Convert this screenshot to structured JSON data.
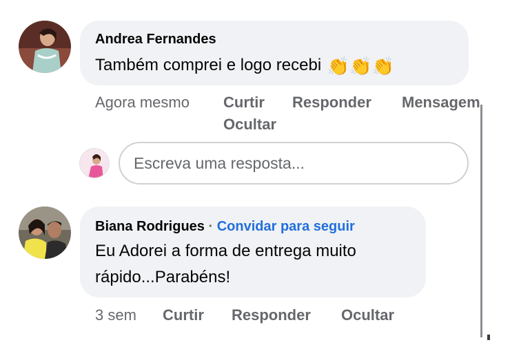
{
  "comments": [
    {
      "author": "Andrea Fernandes",
      "text": "Também comprei e logo recebi",
      "emoji": "👏👏👏",
      "avatar_icon": "profile-photo-woman",
      "actions": {
        "time": "Agora mesmo",
        "like": "Curtir",
        "reply": "Responder",
        "message": "Mensagem",
        "hide": "Ocultar"
      }
    },
    {
      "author": "Biana Rodrigues",
      "separator": "·",
      "follow": "Convidar para seguir",
      "text_line1": "Eu Adorei a forma de entrega muito",
      "text_line2": "rápido...Parabéns!",
      "avatar_icon": "profile-photo-couple",
      "actions": {
        "time": "3 sem",
        "like": "Curtir",
        "reply": "Responder",
        "hide": "Ocultar"
      }
    }
  ],
  "reply_box": {
    "placeholder": "Escreva uma resposta...",
    "avatar_icon": "profile-photo-small"
  },
  "colors": {
    "bubble": "#f0f2f5",
    "secondary_text": "#65676b",
    "link": "#216fdb"
  }
}
